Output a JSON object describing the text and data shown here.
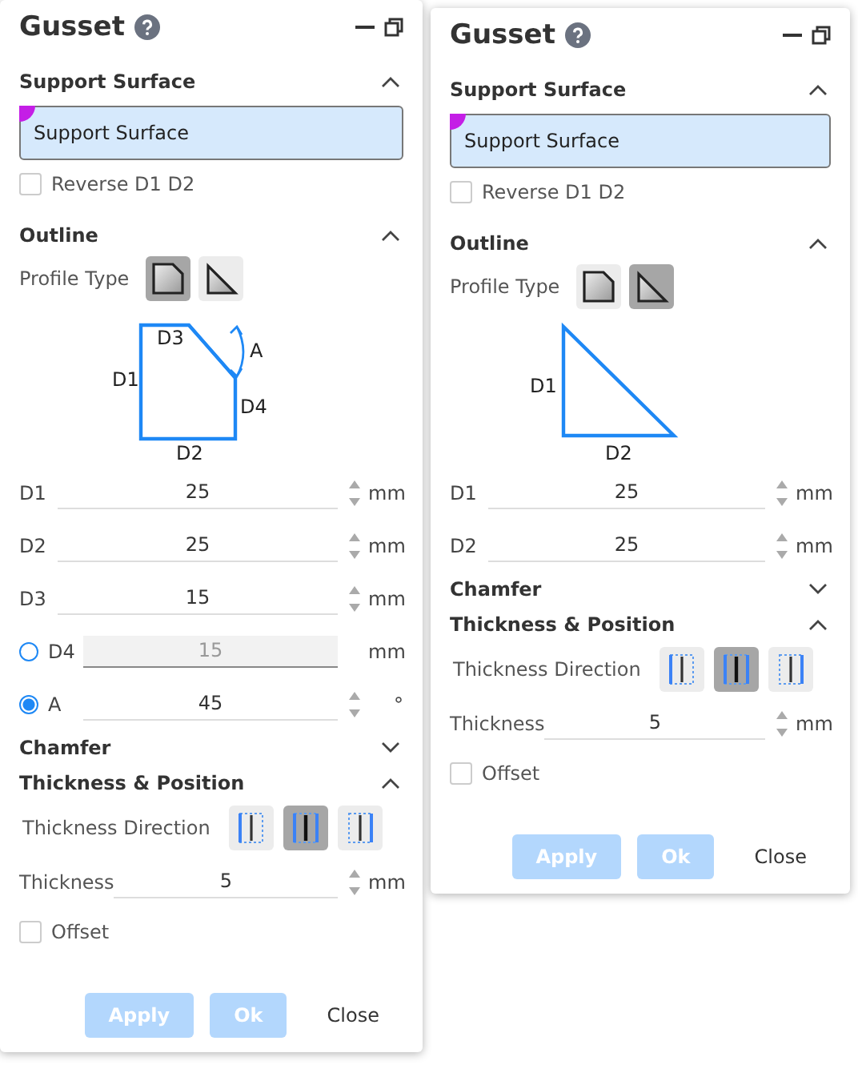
{
  "panels": [
    {
      "title": "Gusset",
      "support_surface": {
        "heading": "Support Surface",
        "expanded": true,
        "value": "Support Surface",
        "reverse": {
          "label": "Reverse D1 D2",
          "checked": false
        }
      },
      "outline": {
        "heading": "Outline",
        "expanded": true,
        "profile_label": "Profile Type",
        "profiles": [
          {
            "kind": "chamfered",
            "selected": true
          },
          {
            "kind": "triangle",
            "selected": false
          }
        ],
        "diagram": {
          "kind": "chamfered",
          "labels": [
            "D3",
            "A",
            "D1",
            "D4",
            "D2"
          ]
        },
        "params": [
          {
            "kind": "spin",
            "label": "D1",
            "value": "25",
            "unit": "mm"
          },
          {
            "kind": "spin",
            "label": "D2",
            "value": "25",
            "unit": "mm"
          },
          {
            "kind": "spin",
            "label": "D3",
            "value": "15",
            "unit": "mm"
          },
          {
            "kind": "radio",
            "label": "D4",
            "value": "15",
            "unit": "mm",
            "selected": false
          },
          {
            "kind": "radio",
            "label": "A",
            "value": "45",
            "unit": "°",
            "selected": true
          }
        ]
      },
      "chamfer": {
        "heading": "Chamfer",
        "expanded": false
      },
      "thickness": {
        "heading": "Thickness & Position",
        "expanded": true,
        "direction_label": "Thickness Direction",
        "directions": [
          {
            "kind": "left",
            "selected": false
          },
          {
            "kind": "center",
            "selected": true
          },
          {
            "kind": "right",
            "selected": false
          }
        ],
        "thickness_label": "Thickness",
        "value": "5",
        "unit": "mm"
      },
      "offset": {
        "label": "Offset",
        "checked": false
      },
      "buttons": [
        {
          "label": "Apply",
          "kind": "primary",
          "disabled": true
        },
        {
          "label": "Ok",
          "kind": "primary",
          "disabled": true
        },
        {
          "label": "Close",
          "kind": "plain",
          "disabled": false
        }
      ]
    },
    {
      "title": "Gusset",
      "support_surface": {
        "heading": "Support Surface",
        "expanded": true,
        "value": "Support Surface",
        "reverse": {
          "label": "Reverse D1 D2",
          "checked": false
        }
      },
      "outline": {
        "heading": "Outline",
        "expanded": true,
        "profile_label": "Profile Type",
        "profiles": [
          {
            "kind": "chamfered",
            "selected": false
          },
          {
            "kind": "triangle",
            "selected": true
          }
        ],
        "diagram": {
          "kind": "triangle",
          "labels": [
            "D1",
            "D2"
          ]
        },
        "params": [
          {
            "kind": "spin",
            "label": "D1",
            "value": "25",
            "unit": "mm"
          },
          {
            "kind": "spin",
            "label": "D2",
            "value": "25",
            "unit": "mm"
          }
        ]
      },
      "chamfer": {
        "heading": "Chamfer",
        "expanded": false
      },
      "thickness": {
        "heading": "Thickness & Position",
        "expanded": true,
        "direction_label": "Thickness Direction",
        "directions": [
          {
            "kind": "left",
            "selected": false
          },
          {
            "kind": "center",
            "selected": true
          },
          {
            "kind": "right",
            "selected": false
          }
        ],
        "thickness_label": "Thickness",
        "value": "5",
        "unit": "mm"
      },
      "offset": {
        "label": "Offset",
        "checked": false
      },
      "buttons": [
        {
          "label": "Apply",
          "kind": "primary",
          "disabled": true
        },
        {
          "label": "Ok",
          "kind": "primary",
          "disabled": true
        },
        {
          "label": "Close",
          "kind": "plain",
          "disabled": false
        }
      ]
    }
  ]
}
